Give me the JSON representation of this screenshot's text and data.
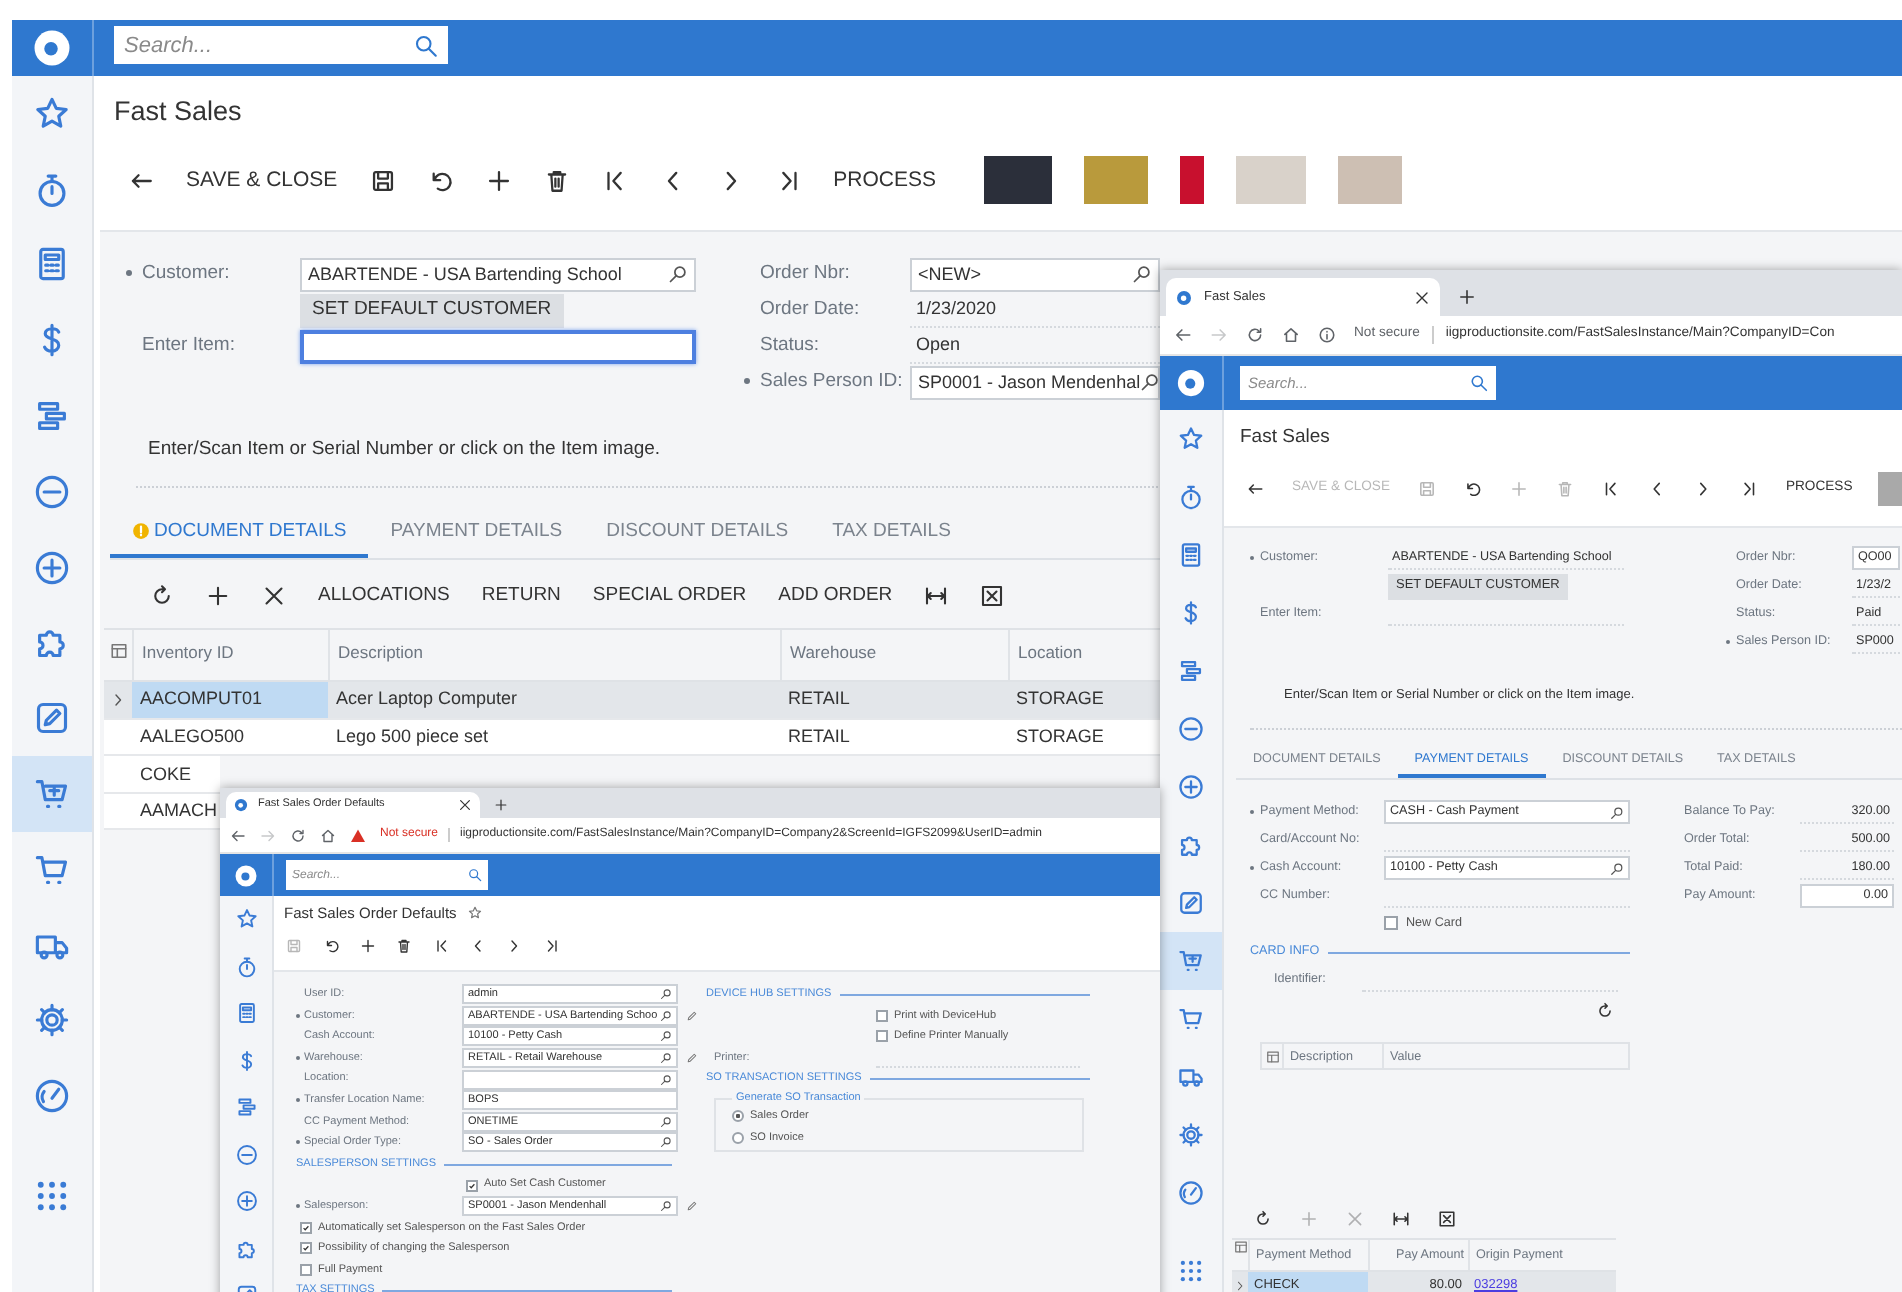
{
  "main": {
    "search": {
      "placeholder": "Search..."
    },
    "sidebar": [
      {
        "kind": "star",
        "selected": false
      },
      {
        "kind": "timer",
        "selected": false
      },
      {
        "kind": "calc",
        "selected": false
      },
      {
        "kind": "dollar",
        "selected": false
      },
      {
        "kind": "bars",
        "selected": false
      },
      {
        "kind": "minus",
        "selected": false
      },
      {
        "kind": "pluscircle",
        "selected": false
      },
      {
        "kind": "puzzle",
        "selected": false
      },
      {
        "kind": "pencilsq",
        "selected": false
      },
      {
        "kind": "cartplus",
        "selected": true
      },
      {
        "kind": "cart",
        "selected": false
      },
      {
        "kind": "truck",
        "selected": false
      },
      {
        "kind": "gear",
        "selected": false
      },
      {
        "kind": "gauge",
        "selected": false
      },
      {
        "kind": "dots",
        "selected": false
      }
    ],
    "title": "Fast Sales",
    "toolbar": [
      {
        "kind": "back",
        "disabled": false
      },
      {
        "kind": "text",
        "label": "SAVE & CLOSE",
        "disabled": false
      },
      {
        "kind": "save",
        "disabled": false
      },
      {
        "kind": "undo",
        "disabled": false
      },
      {
        "kind": "plus",
        "disabled": false
      },
      {
        "kind": "trash",
        "disabled": false
      },
      {
        "kind": "first",
        "disabled": false
      },
      {
        "kind": "prev",
        "disabled": false
      },
      {
        "kind": "next",
        "disabled": false
      },
      {
        "kind": "last",
        "disabled": false
      },
      {
        "kind": "text",
        "label": "PROCESS",
        "disabled": false
      }
    ],
    "form_left": [
      {
        "kind": "lookup",
        "label": "Customer:",
        "required": true,
        "value": "ABARTENDE - USA Bartending School"
      },
      {
        "kind": "button",
        "label": "SET DEFAULT CUSTOMER"
      },
      {
        "kind": "input",
        "label": "Enter Item:",
        "required": false,
        "focused": true
      }
    ],
    "form_right": [
      {
        "kind": "lookup",
        "label": "Order Nbr:",
        "required": false,
        "value": "<NEW>"
      },
      {
        "kind": "text",
        "label": "Order Date:",
        "required": false,
        "value": "1/23/2020"
      },
      {
        "kind": "text",
        "label": "Status:",
        "required": false,
        "value": "Open"
      },
      {
        "kind": "lookup",
        "label": "Sales Person ID:",
        "required": true,
        "value": "SP0001 - Jason Mendenhal"
      }
    ],
    "hint": "Enter/Scan Item or Serial Number or click on the Item image.",
    "tabs": [
      {
        "label": "DOCUMENT DETAILS",
        "selected": true,
        "warning": true
      },
      {
        "label": "PAYMENT DETAILS",
        "selected": false,
        "warning": false
      },
      {
        "label": "DISCOUNT DETAILS",
        "selected": false,
        "warning": false
      },
      {
        "label": "TAX DETAILS",
        "selected": false,
        "warning": false
      }
    ],
    "grid_toolbar": [
      {
        "kind": "refresh",
        "disabled": false
      },
      {
        "kind": "plus",
        "disabled": false
      },
      {
        "kind": "close",
        "disabled": false
      },
      {
        "kind": "text",
        "label": "ALLOCATIONS",
        "disabled": false
      },
      {
        "kind": "text",
        "label": "RETURN",
        "disabled": false
      },
      {
        "kind": "text",
        "label": "SPECIAL ORDER",
        "disabled": false
      },
      {
        "kind": "text",
        "label": "ADD ORDER",
        "disabled": false
      },
      {
        "kind": "fit",
        "disabled": false
      },
      {
        "kind": "excel",
        "disabled": false
      }
    ],
    "columns": [
      "Inventory ID",
      "Description",
      "Warehouse",
      "Location"
    ],
    "rows": [
      {
        "cells": [
          "AACOMPUT01",
          "Acer Laptop Computer",
          "RETAIL",
          "STORAGE"
        ],
        "selected": true
      },
      {
        "cells": [
          "AALEGO500",
          "Lego 500 piece set",
          "RETAIL",
          "STORAGE"
        ],
        "selected": false
      },
      {
        "cells": [
          "COKE"
        ],
        "selected": false
      },
      {
        "cells": [
          "AAMACH"
        ],
        "selected": false
      }
    ]
  },
  "defaults_window": {
    "tab_title": "Fast Sales Order Defaults",
    "security": {
      "kind": "warning",
      "label": "Not secure"
    },
    "url": "iigproductionsite.com/FastSalesInstance/Main?CompanyID=Company2&ScreenId=IGFS2099&UserID=admin",
    "search": {
      "placeholder": "Search..."
    },
    "sidebar": [
      {
        "kind": "star",
        "selected": false
      },
      {
        "kind": "timer",
        "selected": false
      },
      {
        "kind": "calc",
        "selected": false
      },
      {
        "kind": "dollar",
        "selected": false
      },
      {
        "kind": "bars",
        "selected": false
      },
      {
        "kind": "minus",
        "selected": false
      },
      {
        "kind": "pluscircle",
        "selected": false
      },
      {
        "kind": "puzzle",
        "selected": false
      },
      {
        "kind": "pencilsq",
        "selected": false
      }
    ],
    "title": "Fast Sales Order Defaults",
    "toolbar": [
      {
        "kind": "save",
        "disabled": true
      },
      {
        "kind": "undo",
        "disabled": false
      },
      {
        "kind": "plus",
        "disabled": false
      },
      {
        "kind": "trash",
        "disabled": false
      },
      {
        "kind": "first",
        "disabled": false
      },
      {
        "kind": "prev",
        "disabled": false
      },
      {
        "kind": "next",
        "disabled": false
      },
      {
        "kind": "last",
        "disabled": false
      }
    ],
    "left": [
      {
        "kind": "field",
        "label": "User ID:",
        "required": false,
        "value": "admin",
        "lookup": true,
        "edit": false
      },
      {
        "kind": "field",
        "label": "Customer:",
        "required": true,
        "value": "ABARTENDE - USA Bartending Schoo",
        "lookup": true,
        "edit": true
      },
      {
        "kind": "field",
        "label": "Cash Account:",
        "required": false,
        "value": "10100 - Petty Cash",
        "lookup": true,
        "edit": false
      },
      {
        "kind": "field",
        "label": "Warehouse:",
        "required": true,
        "value": "RETAIL - Retail Warehouse",
        "lookup": true,
        "edit": true
      },
      {
        "kind": "field",
        "label": "Location:",
        "required": false,
        "lookup": true,
        "edit": false
      },
      {
        "kind": "field",
        "label": "Transfer Location Name:",
        "required": true,
        "value": "BOPS",
        "lookup": false,
        "edit": false
      },
      {
        "kind": "field",
        "label": "CC Payment Method:",
        "required": false,
        "value": "ONETIME",
        "lookup": true,
        "edit": false
      },
      {
        "kind": "field",
        "label": "Special Order Type:",
        "required": true,
        "value": "SO - Sales Order",
        "lookup": true,
        "edit": false
      },
      {
        "kind": "section",
        "label": "SALESPERSON SETTINGS"
      },
      {
        "kind": "field_checkbox",
        "label": "Auto Set Cash Customer",
        "checked": true
      },
      {
        "kind": "field",
        "label": "Salesperson:",
        "required": true,
        "value": "SP0001 - Jason Mendenhall",
        "lookup": true,
        "edit": true
      },
      {
        "kind": "checkbox",
        "label": "Automatically set Salesperson on the Fast Sales Order",
        "checked": true
      },
      {
        "kind": "checkbox",
        "label": "Possibility of changing the Salesperson",
        "checked": true
      },
      {
        "kind": "checkbox",
        "label": "Full Payment",
        "checked": false
      },
      {
        "kind": "section",
        "label": "TAX SETTINGS"
      }
    ],
    "right": [
      {
        "kind": "section",
        "label": "DEVICE HUB SETTINGS"
      },
      {
        "kind": "field_checkbox",
        "label": "Print with DeviceHub",
        "checked": false
      },
      {
        "kind": "field_checkbox",
        "label": "Define Printer Manually",
        "checked": false
      },
      {
        "kind": "line",
        "label": "Printer:"
      },
      {
        "kind": "section",
        "label": "SO TRANSACTION SETTINGS"
      },
      {
        "kind": "radio_group",
        "label": "Generate SO Transaction",
        "options": [
          {
            "label": "Sales Order",
            "selected": true
          },
          {
            "label": "SO Invoice",
            "selected": false
          }
        ]
      }
    ]
  },
  "fast_sales_window": {
    "tab_title": "Fast Sales",
    "security": {
      "kind": "info",
      "label": "Not secure"
    },
    "url": "iigproductionsite.com/FastSalesInstance/Main?CompanyID=Con",
    "search": {
      "placeholder": "Search..."
    },
    "sidebar": [
      {
        "kind": "star",
        "selected": false
      },
      {
        "kind": "timer",
        "selected": false
      },
      {
        "kind": "calc",
        "selected": false
      },
      {
        "kind": "dollar",
        "selected": false
      },
      {
        "kind": "bars",
        "selected": false
      },
      {
        "kind": "minus",
        "selected": false
      },
      {
        "kind": "pluscircle",
        "selected": false
      },
      {
        "kind": "puzzle",
        "selected": false
      },
      {
        "kind": "pencilsq",
        "selected": false
      },
      {
        "kind": "cartplus",
        "selected": true
      },
      {
        "kind": "cart",
        "selected": false
      },
      {
        "kind": "truck",
        "selected": false
      },
      {
        "kind": "gear",
        "selected": false
      },
      {
        "kind": "gauge",
        "selected": false
      },
      {
        "kind": "dots",
        "selected": false
      }
    ],
    "title": "Fast Sales",
    "toolbar": [
      {
        "kind": "back",
        "disabled": false
      },
      {
        "kind": "text",
        "label": "SAVE & CLOSE",
        "disabled": true
      },
      {
        "kind": "save",
        "disabled": true
      },
      {
        "kind": "undo",
        "disabled": false
      },
      {
        "kind": "plus",
        "disabled": true
      },
      {
        "kind": "trash",
        "disabled": true
      },
      {
        "kind": "first",
        "disabled": false
      },
      {
        "kind": "prev",
        "disabled": false
      },
      {
        "kind": "next",
        "disabled": false
      },
      {
        "kind": "last",
        "disabled": false
      },
      {
        "kind": "text",
        "label": "PROCESS",
        "disabled": false
      }
    ],
    "form_left": [
      {
        "kind": "text",
        "label": "Customer:",
        "required": true,
        "value": "ABARTENDE - USA Bartending School"
      },
      {
        "kind": "button",
        "label": "SET DEFAULT CUSTOMER"
      },
      {
        "kind": "text",
        "label": "Enter Item:",
        "required": false
      }
    ],
    "form_right": [
      {
        "kind": "input",
        "label": "Order Nbr:",
        "required": false,
        "value": "QO00"
      },
      {
        "kind": "text",
        "label": "Order Date:",
        "required": false,
        "value": "1/23/2"
      },
      {
        "kind": "text",
        "label": "Status:",
        "required": false,
        "value": "Paid"
      },
      {
        "kind": "text",
        "label": "Sales Person ID:",
        "required": true,
        "value": "SP000"
      }
    ],
    "hint": "Enter/Scan Item or Serial Number or click on the Item image.",
    "tabs": [
      {
        "label": "DOCUMENT DETAILS",
        "selected": false,
        "warning": false
      },
      {
        "label": "PAYMENT DETAILS",
        "selected": true,
        "warning": false
      },
      {
        "label": "DISCOUNT DETAILS",
        "selected": false,
        "warning": false
      },
      {
        "label": "TAX DETAILS",
        "selected": false,
        "warning": false
      }
    ],
    "payment_left": [
      {
        "kind": "lookup",
        "label": "Payment Method:",
        "required": true,
        "value": "CASH - Cash Payment"
      },
      {
        "kind": "text",
        "label": "Card/Account No:",
        "required": false
      },
      {
        "kind": "lookup",
        "label": "Cash Account:",
        "required": true,
        "value": "10100 - Petty Cash"
      },
      {
        "kind": "text",
        "label": "CC Number:",
        "required": false
      },
      {
        "kind": "checkbox",
        "label": "New Card",
        "checked": false
      }
    ],
    "card_info": {
      "title": "CARD INFO",
      "identifier_label": "Identifier:",
      "columns": [
        "Description",
        "Value"
      ]
    },
    "totals": [
      {
        "kind": "text",
        "label": "Balance To Pay:",
        "value": "320.00"
      },
      {
        "kind": "text",
        "label": "Order Total:",
        "value": "500.00"
      },
      {
        "kind": "text",
        "label": "Total Paid:",
        "value": "180.00"
      },
      {
        "kind": "input",
        "label": "Pay Amount:",
        "value": "0.00"
      }
    ],
    "grid_toolbar": [
      {
        "kind": "refresh",
        "disabled": false
      },
      {
        "kind": "plus",
        "disabled": true
      },
      {
        "kind": "close",
        "disabled": true
      },
      {
        "kind": "fit",
        "disabled": false
      },
      {
        "kind": "excel",
        "disabled": false
      }
    ],
    "payments": {
      "columns": [
        "Payment Method",
        "Pay Amount",
        "Origin Payment"
      ],
      "rows": [
        {
          "method": "CHECK",
          "amount": "80.00",
          "origin": "032298",
          "selected": true
        }
      ]
    }
  }
}
